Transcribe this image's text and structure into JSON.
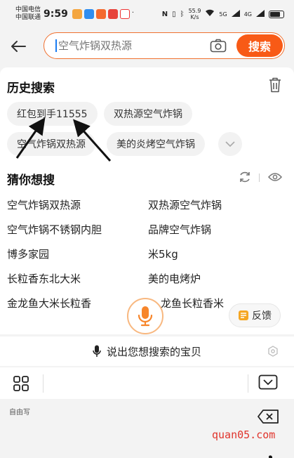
{
  "status_bar": {
    "carrier_1": "中国电信",
    "carrier_2": "中国联通",
    "time": "9:59",
    "net_speed": "55.9",
    "net_unit": "K/s",
    "signal_1": "5G",
    "signal_2": "4G"
  },
  "search": {
    "placeholder": "空气炸锅双热源",
    "button_label": "搜索",
    "accent": "#f85a16"
  },
  "history": {
    "title": "历史搜索",
    "items": [
      "红包到手11555",
      "双热源空气炸锅",
      "空气炸锅双热源",
      "美的炎烤空气炸锅"
    ]
  },
  "guess": {
    "title": "猜你想搜",
    "items": [
      "空气炸锅双热源",
      "双热源空气炸锅",
      "空气炸锅不锈钢内胆",
      "品牌空气炸锅",
      "博多家园",
      "米5kg",
      "长粒香东北大米",
      "美的电烤炉",
      "金龙鱼大米长粒香",
      "龙鱼长粒香米"
    ]
  },
  "feedback_label": "反馈",
  "keyboard": {
    "voice_prompt": "说出您想搜索的宝贝",
    "handwriting_label": "自由写",
    "watermark": "quan05.com",
    "comma": "，"
  }
}
